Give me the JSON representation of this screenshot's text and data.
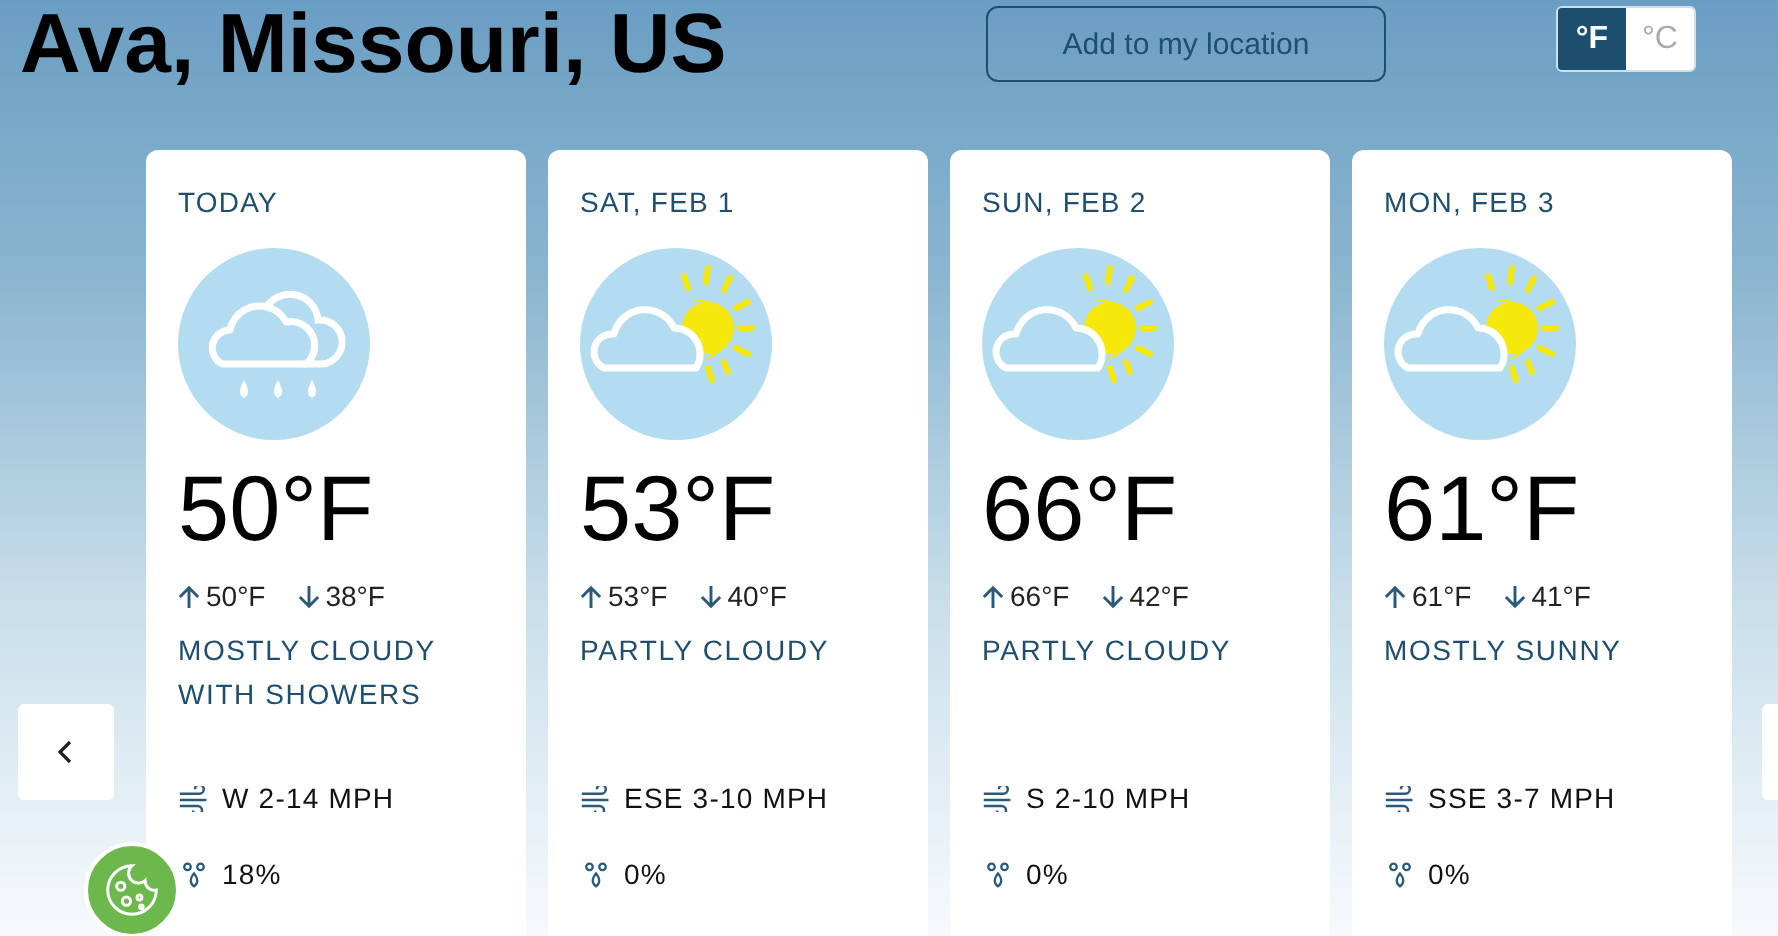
{
  "location": {
    "title": "Ava, Missouri, US"
  },
  "add_button": {
    "label": "Add to my location"
  },
  "units": [
    {
      "label": "°F",
      "selected": true
    },
    {
      "label": "°C",
      "selected": false
    }
  ],
  "days": [
    {
      "date": "TODAY",
      "kind": "showers",
      "temp": "50°F",
      "high": "50°F",
      "low": "38°F",
      "condition": "MOSTLY CLOUDY WITH SHOWERS",
      "wind": "W 2-14 MPH",
      "precip": "18%"
    },
    {
      "date": "SAT, FEB 1",
      "kind": "partly-sunny",
      "temp": "53°F",
      "high": "53°F",
      "low": "40°F",
      "condition": "PARTLY CLOUDY",
      "wind": "ESE 3-10 MPH",
      "precip": "0%"
    },
    {
      "date": "SUN, FEB 2",
      "kind": "partly-sunny",
      "temp": "66°F",
      "high": "66°F",
      "low": "42°F",
      "condition": "PARTLY CLOUDY",
      "wind": "S 2-10 MPH",
      "precip": "0%"
    },
    {
      "date": "MON, FEB 3",
      "kind": "partly-sunny",
      "temp": "61°F",
      "high": "61°F",
      "low": "41°F",
      "condition": "MOSTLY SUNNY",
      "wind": "SSE 3-7 MPH",
      "precip": "0%"
    }
  ]
}
